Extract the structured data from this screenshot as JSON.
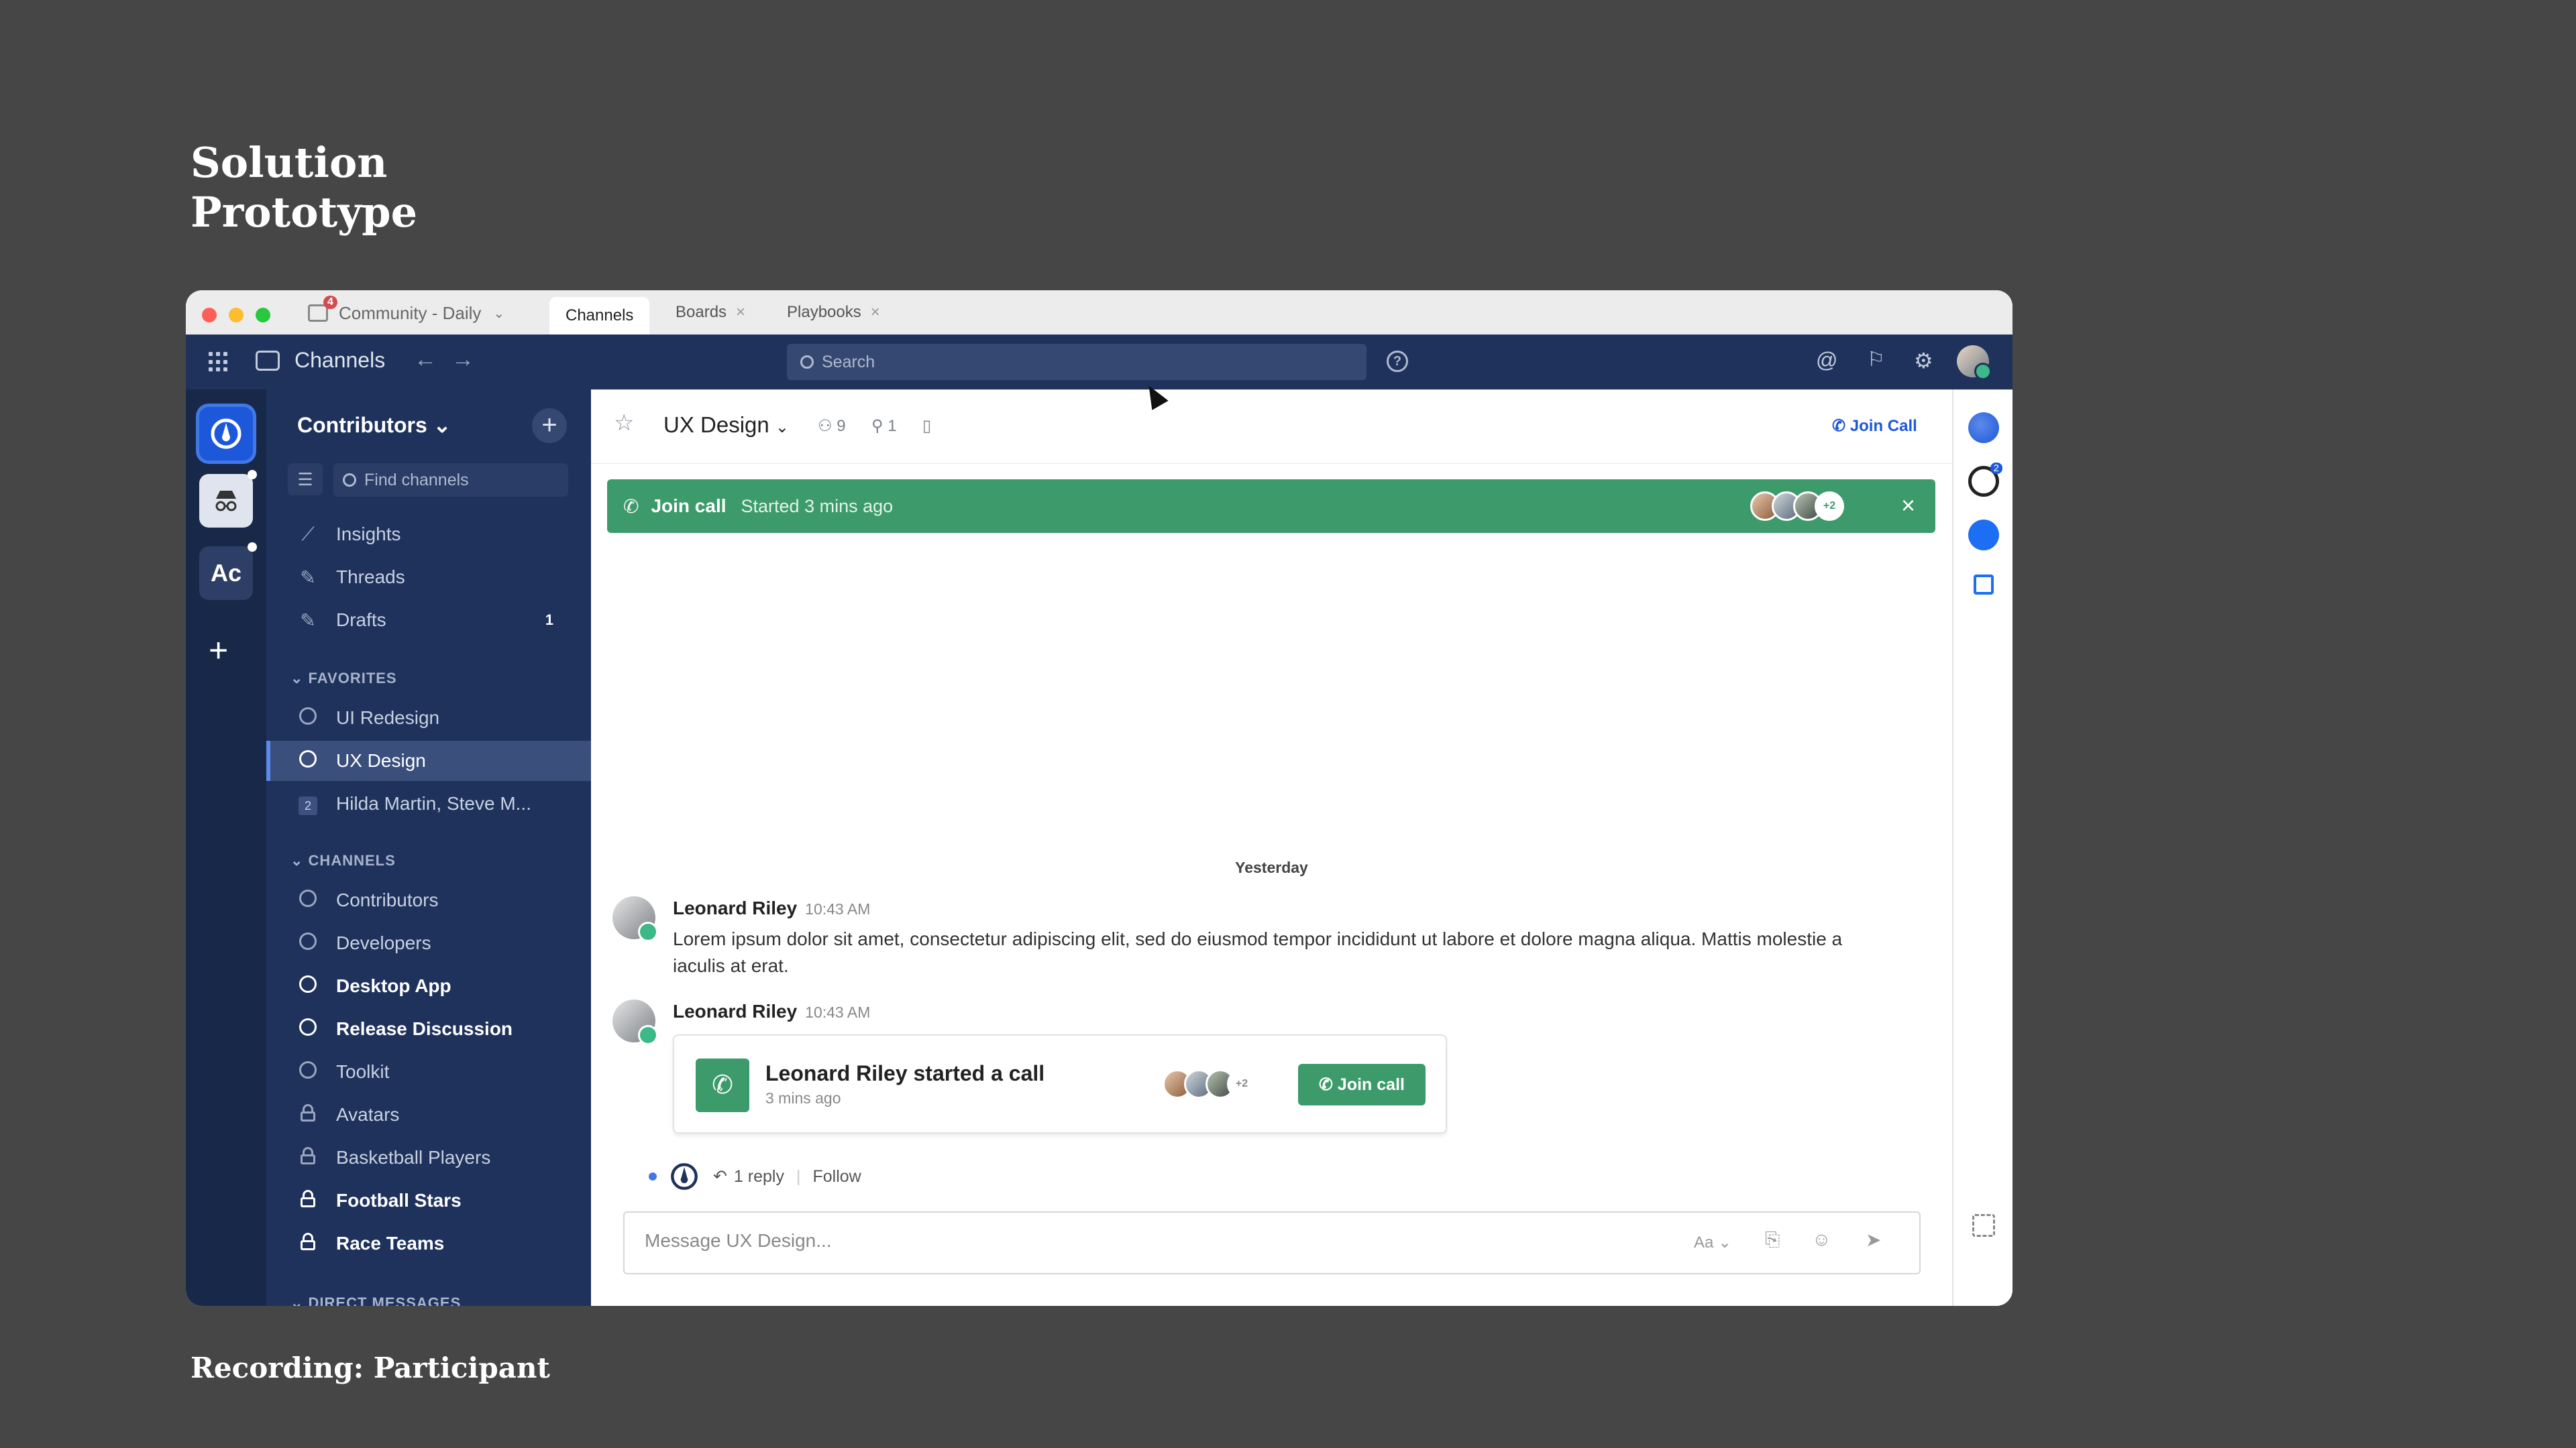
{
  "slide": {
    "title": "Solution\nPrototype",
    "caption": "Recording: Participant"
  },
  "titlebar": {
    "server": "Community - Daily",
    "server_badge": "4",
    "tabs": [
      "Channels",
      "Boards",
      "Playbooks"
    ]
  },
  "header": {
    "product": "Channels",
    "search_placeholder": "Search"
  },
  "team_rail": {
    "teams": [
      "Ac"
    ]
  },
  "sidebar": {
    "team_name": "Contributors",
    "find_placeholder": "Find channels",
    "top_items": [
      {
        "label": "Insights",
        "icon": "insights-icon"
      },
      {
        "label": "Threads",
        "icon": "threads-icon"
      },
      {
        "label": "Drafts",
        "icon": "drafts-icon",
        "count": "1"
      }
    ],
    "favorites_label": "FAVORITES",
    "favorites": [
      {
        "label": "UI Redesign"
      },
      {
        "label": "UX Design"
      },
      {
        "label": "Hilda Martin, Steve M...",
        "badge": "2"
      }
    ],
    "channels_label": "CHANNELS",
    "channels": [
      {
        "label": "Contributors"
      },
      {
        "label": "Developers"
      },
      {
        "label": "Desktop App"
      },
      {
        "label": "Release Discussion"
      },
      {
        "label": "Toolkit"
      },
      {
        "label": "Avatars"
      },
      {
        "label": "Basketball Players"
      },
      {
        "label": "Football Stars"
      },
      {
        "label": "Race Teams"
      }
    ],
    "dm_label": "DIRECT MESSAGES"
  },
  "channel": {
    "name": "UX Design",
    "members": "9",
    "pinned": "1",
    "join_call": "Join Call",
    "banner": {
      "title": "Join call",
      "status": "Started 3 mins ago",
      "more": "+2"
    },
    "date_separator": "Yesterday",
    "posts": [
      {
        "author": "Leonard Riley",
        "time": "10:43 AM",
        "text": "Lorem ipsum dolor sit amet, consectetur adipiscing elit, sed do eiusmod tempor incididunt ut labore et dolore magna aliqua. Mattis molestie a iaculis at erat."
      },
      {
        "author": "Leonard Riley",
        "time": "10:43 AM",
        "call": {
          "title": "Leonard Riley started a call",
          "subtitle": "3 mins ago",
          "more": "+2",
          "button": "Join call"
        }
      }
    ],
    "replies": "1 reply",
    "follow": "Follow",
    "message_placeholder": "Message UX Design...",
    "format_label": "Aa"
  },
  "app_bar": {
    "github_badge": "2"
  }
}
